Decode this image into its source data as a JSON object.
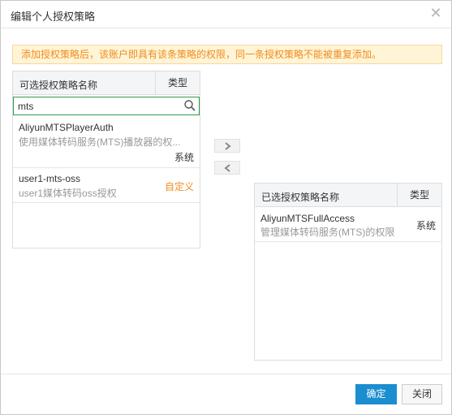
{
  "dialog": {
    "title": "编辑个人授权策略",
    "close_icon": "close-icon"
  },
  "notice": "添加授权策略后，该账户即具有该条策略的权限，同一条授权策略不能被重复添加。",
  "available": {
    "col_name": "可选授权策略名称",
    "col_type": "类型",
    "search": {
      "value": "mts",
      "placeholder": "",
      "icon": "search-icon"
    },
    "items": [
      {
        "name": "AliyunMTSPlayerAuth",
        "desc": "使用媒体转码服务(MTS)播放器的权...",
        "type": "系统"
      },
      {
        "name": "user1-mts-oss",
        "desc": "user1媒体转码oss授权",
        "type": "自定义"
      }
    ]
  },
  "transfer": {
    "add_icon": "chevron-right-icon",
    "remove_icon": "chevron-left-icon"
  },
  "selected": {
    "col_name": "已选授权策略名称",
    "col_type": "类型",
    "items": [
      {
        "name": "AliyunMTSFullAccess",
        "desc": "管理媒体转码服务(MTS)的权限",
        "type": "系统"
      }
    ]
  },
  "footer": {
    "ok_label": "确定",
    "cancel_label": "关闭"
  },
  "colors": {
    "primary": "#1a8ecf",
    "notice_bg": "#fff4d6",
    "notice_text": "#f08c1e",
    "search_border": "#2d9c4a",
    "custom_type": "#f08c1e"
  }
}
